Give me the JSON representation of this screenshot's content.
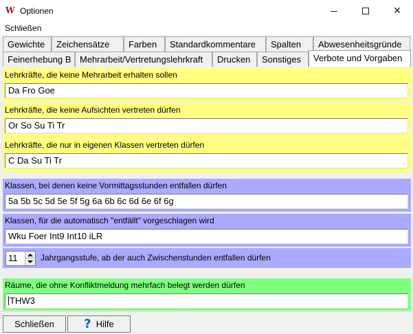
{
  "window": {
    "title": "Optionen",
    "icon": "untis-logo-icon",
    "controls": {
      "minimize": "minimize-icon",
      "maximize": "maximize-icon",
      "close": "close-icon"
    }
  },
  "menu": {
    "items": [
      "Schließen"
    ]
  },
  "tabs": {
    "row1": [
      "Gewichte",
      "Zeichensätze",
      "Farben",
      "Standardkommentare",
      "Spalten",
      "Abwesenheitsgründe"
    ],
    "row2": [
      "Feinerhebung B",
      "Mehrarbeit/Vertretungslehrkraft",
      "Drucken",
      "Sonstiges",
      "Verbote und Vorgaben"
    ],
    "active": "Verbote und Vorgaben"
  },
  "sections": {
    "keine_mehrarbeit": {
      "label": "Lehrkräfte, die keine Mehrarbeit erhalten sollen",
      "value": "Da Fro Goe"
    },
    "keine_aufsichten": {
      "label": "Lehrkräfte, die keine Aufsichten vertreten dürfen",
      "value": "Or So Su Ti Tr"
    },
    "eigene_klassen": {
      "label": "Lehrkräfte, die nur in eigenen Klassen vertreten dürfen",
      "value": "C Da Su Ti Tr"
    },
    "keine_vormittag": {
      "label": "Klassen, bei denen keine Vormittagsstunden entfallen dürfen",
      "value": "5a 5b 5c 5d 5e 5f 5g 6a 6b 6c 6d 6e 6f 6g"
    },
    "entfaellt_vorschlag": {
      "label": "Klassen, für die automatisch \"entfällt\" vorgeschlagen wird",
      "value": "Wku Foer Int9 Int10 iLR"
    },
    "jahrgangsstufe": {
      "value": "11",
      "label": "Jahrgangsstufe, ab der auch Zwischenstunden entfallen dürfen"
    },
    "raeume": {
      "label": "Räume, die ohne Konfliktmeldung mehrfach belegt werden dürfen",
      "value": "THW3"
    }
  },
  "buttons": {
    "close": "Schließen",
    "help": "Hilfe",
    "help_icon": "question-mark-icon"
  },
  "colors": {
    "teacher_sections": "#ffff80",
    "class_sections": "#aaaaff",
    "room_section": "#80ff80",
    "help_icon": "#1060d0"
  }
}
